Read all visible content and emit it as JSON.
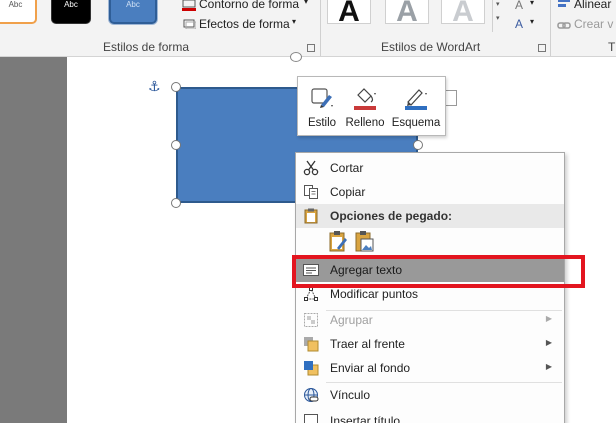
{
  "ribbon": {
    "swatches": [
      "Abc",
      "Abc",
      "Abc"
    ],
    "shape_outline_label": "Contorno de forma",
    "shape_effects_label": "Efectos de forma",
    "shape_styles_group": "Estilos de forma",
    "wordart_letter": "A",
    "wordart_group": "Estilos de WordArt",
    "align_label": "Alinear",
    "create_link_label": "Crear v"
  },
  "mini_toolbar": {
    "style_label": "Estilo",
    "fill_label": "Relleno",
    "outline_label": "Esquema"
  },
  "context_menu": {
    "cut": "Cortar",
    "copy": "Copiar",
    "paste_options": "Opciones de pegado:",
    "add_text": "Agregar texto",
    "edit_points": "Modificar puntos",
    "group": "Agrupar",
    "bring_to_front": "Traer al frente",
    "send_to_back": "Enviar al fondo",
    "link": "Vínculo",
    "insert_caption": "Insertar título..."
  },
  "colors": {
    "shape_fill": "#4a7ebf",
    "highlight_border": "#e3151f",
    "menu_highlight": "#999999"
  }
}
